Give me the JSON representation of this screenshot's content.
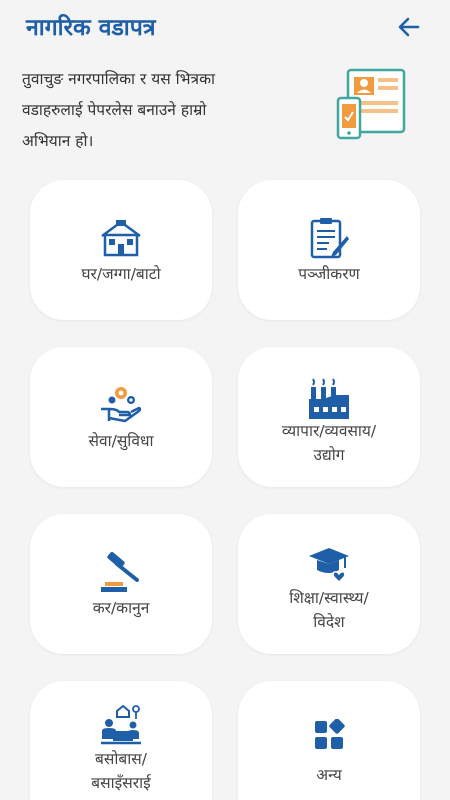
{
  "header": {
    "title": "नागरिक वडापत्र",
    "back_icon": "arrow-left-icon"
  },
  "intro": {
    "text_line1": "तुवाचुङ नगरपालिका र यस भित्रका",
    "text_line2": "वडाहरुलाई पेपरलेस बनाउने हाम्रो",
    "text_line3": "अभियान हो।",
    "illustration_icon": "document-phone-illustration"
  },
  "cards": [
    {
      "label1": "घर/जग्गा/बाटो",
      "label2": "",
      "icon": "house-icon"
    },
    {
      "label1": "पञ्जीकरण",
      "label2": "",
      "icon": "clipboard-pen-icon"
    },
    {
      "label1": "सेवा/सुविधा",
      "label2": "",
      "icon": "hand-gears-icon"
    },
    {
      "label1": "व्यापार/व्यवसाय/",
      "label2": "उद्योग",
      "icon": "factory-icon"
    },
    {
      "label1": "कर/कानुन",
      "label2": "",
      "icon": "gavel-icon"
    },
    {
      "label1": "शिक्षा/स्वास्थ्य/",
      "label2": "विदेश",
      "icon": "graduation-heart-icon"
    },
    {
      "label1": "बसोबास/",
      "label2": "बसाइँसराई",
      "icon": "family-house-icon"
    },
    {
      "label1": "अन्य",
      "label2": "",
      "icon": "shapes-grid-icon"
    }
  ],
  "colors": {
    "primary": "#1f5fa8",
    "background": "#f4f4f4",
    "card": "#ffffff",
    "accent_orange": "#f19a3e",
    "accent_teal": "#3fa6a0"
  }
}
